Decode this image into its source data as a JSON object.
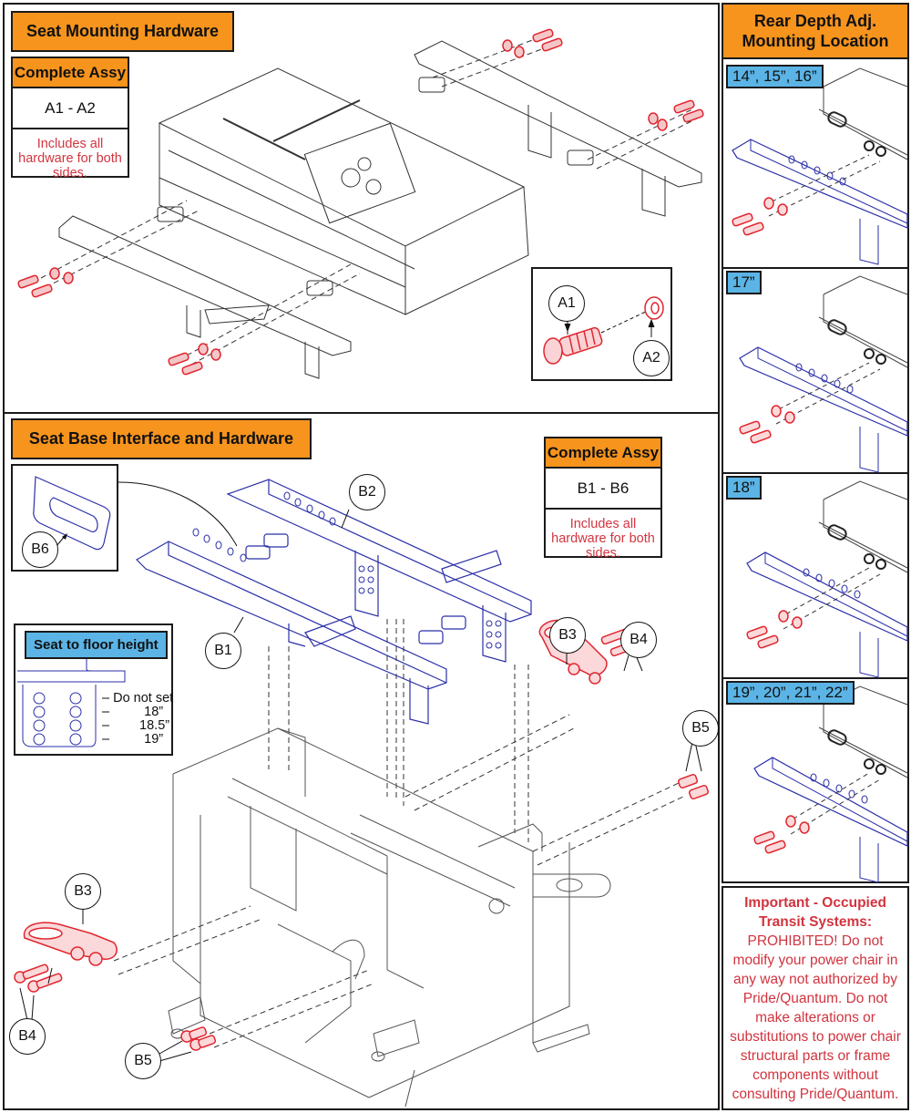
{
  "colors": {
    "header_orange": "#f7941d",
    "tag_blue": "#5bb4e5",
    "note_red": "#d1343f",
    "hardware_red": "#e0262f",
    "part_blue": "#2b2fa8",
    "line_gray": "#333333"
  },
  "seat_mounting": {
    "title": "Seat Mounting Hardware",
    "complete_assy": {
      "header": "Complete Assy",
      "range": "A1 - A2",
      "note": "Includes all hardware for both sides."
    },
    "detail_callouts": [
      {
        "id": "A1",
        "part": "shoulder-bolt"
      },
      {
        "id": "A2",
        "part": "washer"
      }
    ]
  },
  "seat_base": {
    "title": "Seat Base Interface and Hardware",
    "complete_assy": {
      "header": "Complete Assy",
      "range": "B1 - B6",
      "note": "Includes all hardware for both sides."
    },
    "callouts": {
      "b1": "B1",
      "b2": "B2",
      "b3_right": "B3",
      "b3_left": "B3",
      "b4_right": "B4",
      "b4_left": "B4",
      "b5_right": "B5",
      "b5_left": "B5",
      "b6": "B6"
    },
    "seat_to_floor": {
      "label": "Seat to floor height",
      "rows": [
        {
          "dash": "–",
          "value": "Do not set"
        },
        {
          "dash": "–",
          "value": "18”"
        },
        {
          "dash": "–",
          "value": "18.5”"
        },
        {
          "dash": "–",
          "value": "19”"
        }
      ]
    }
  },
  "rear_depth": {
    "title": "Rear Depth Adj. Mounting Location",
    "positions": [
      {
        "label": "14”, 15”, 16”"
      },
      {
        "label": "17”"
      },
      {
        "label": "18”"
      },
      {
        "label": "19”, 20”, 21”, 22”"
      }
    ]
  },
  "warning": {
    "heading": "Important - Occupied Transit Systems:",
    "body": "PROHIBITED! Do not modify your power chair in any way not authorized by Pride/Quantum. Do not make alterations or substitutions to power chair structural parts or frame components without consulting Pride/Quantum."
  }
}
